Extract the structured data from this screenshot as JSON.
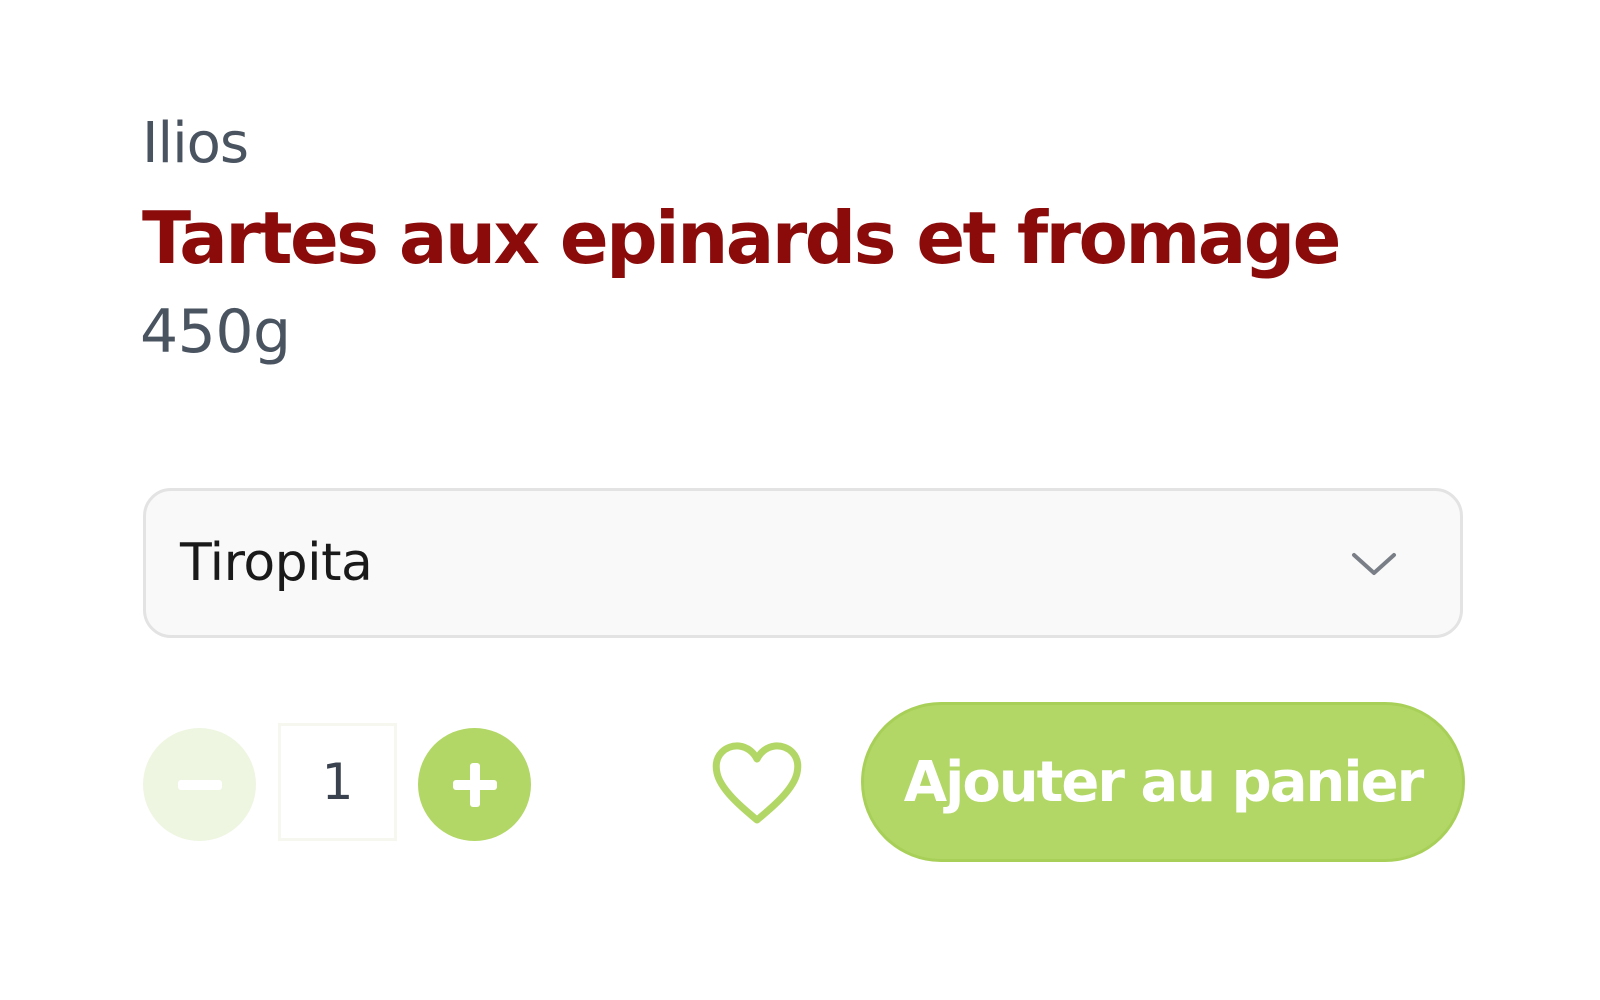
{
  "product": {
    "brand": "Ilios",
    "title": "Tartes aux epinards et fromage",
    "weight": "450g"
  },
  "variant_select": {
    "selected": "Tiropita",
    "icon": "chevron-down-icon"
  },
  "quantity": {
    "value": "1",
    "minus_icon": "minus-icon",
    "plus_icon": "plus-icon"
  },
  "actions": {
    "wishlist_icon": "heart-icon",
    "add_to_cart_label": "Ajouter au panier"
  },
  "colors": {
    "brand_text": "#4a5461",
    "title": "#8b0a0a",
    "accent_green": "#b2d766",
    "disabled_green": "#eef6e2",
    "select_bg": "#f9f9f9",
    "select_border": "#e3e3e3"
  }
}
